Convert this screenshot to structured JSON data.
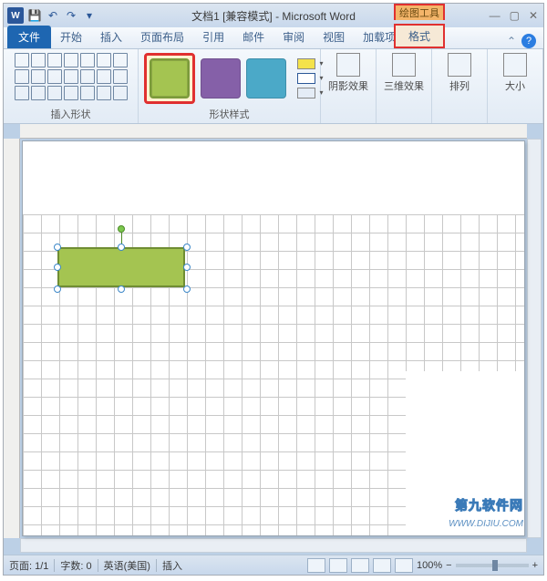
{
  "title": "文档1 [兼容模式] - Microsoft Word",
  "contextual_tab": "绘图工具",
  "tabs": {
    "file": "文件",
    "home": "开始",
    "insert": "插入",
    "layout": "页面布局",
    "refs": "引用",
    "mail": "邮件",
    "review": "审阅",
    "view": "视图",
    "addins": "加载项",
    "format": "格式"
  },
  "ribbon": {
    "group_shapes": "插入形状",
    "group_styles": "形状样式",
    "fill": "形状填充",
    "outline": "形状轮廓",
    "shadow": "阴影效果",
    "threed": "三维效果",
    "arrange": "排列",
    "size": "大小"
  },
  "status": {
    "page": "页面: 1/1",
    "words": "字数: 0",
    "lang": "英语(美国)",
    "mode": "插入",
    "zoom": "100%"
  },
  "watermark": {
    "name": "第九软件网",
    "url": "WWW.DIJIU.COM"
  }
}
